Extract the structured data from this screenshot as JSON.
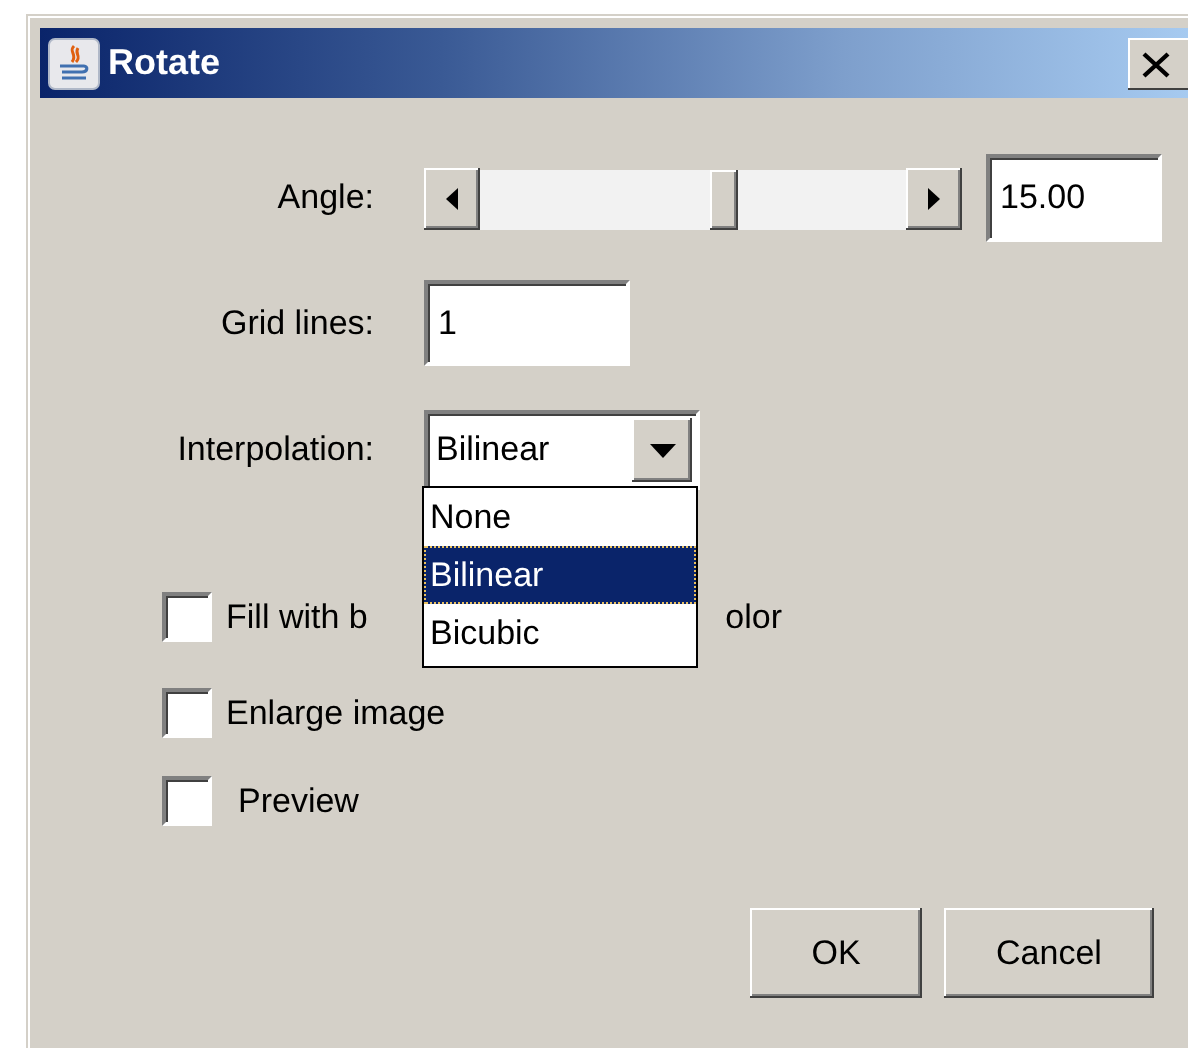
{
  "window": {
    "title": "Rotate"
  },
  "angle": {
    "label": "Angle:",
    "level": 0.58,
    "value": "15.00"
  },
  "grid_lines": {
    "label": "Grid lines:",
    "value": "1"
  },
  "interpolation": {
    "label": "Interpolation:",
    "value": "Bilinear",
    "expanded": true,
    "options": [
      {
        "label": "None",
        "selected": false
      },
      {
        "label": "Bilinear",
        "selected": true
      },
      {
        "label": "Bicubic",
        "selected": false
      }
    ]
  },
  "checkboxes": [
    {
      "label_parts": [
        "Fill with b",
        "olor"
      ],
      "checked": false
    },
    {
      "label_parts": [
        "Enlarge image"
      ],
      "checked": false
    },
    {
      "label_parts": [
        "Preview"
      ],
      "checked": false
    }
  ],
  "buttons": [
    "OK",
    "Cancel"
  ]
}
